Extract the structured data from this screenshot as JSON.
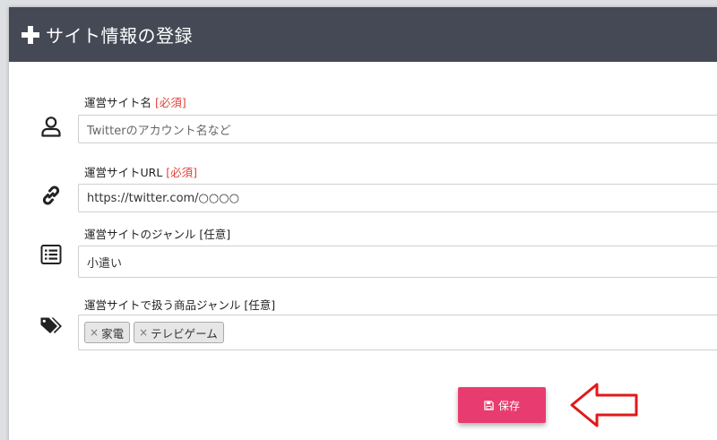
{
  "header": {
    "title": "サイト情報の登録"
  },
  "fields": {
    "site_name": {
      "label": "運営サイト名",
      "badge": "[必須]",
      "placeholder": "Twitterのアカウント名など"
    },
    "site_url": {
      "label": "運営サイトURL",
      "badge": "[必須]",
      "value": "https://twitter.com/○○○○"
    },
    "site_genre": {
      "label": "運営サイトのジャンル [任意]",
      "value": "小遣い"
    },
    "product_genre": {
      "label": "運営サイトで扱う商品ジャンル [任意]",
      "tags": [
        {
          "remove": "×",
          "text": "家電"
        },
        {
          "remove": "×",
          "text": "テレビゲーム"
        }
      ]
    }
  },
  "save_button": {
    "label": "保存"
  },
  "colors": {
    "header_bg": "#444955",
    "required": "#e0433a",
    "save_bg": "#e83c70",
    "arrow": "#e01a1a"
  }
}
